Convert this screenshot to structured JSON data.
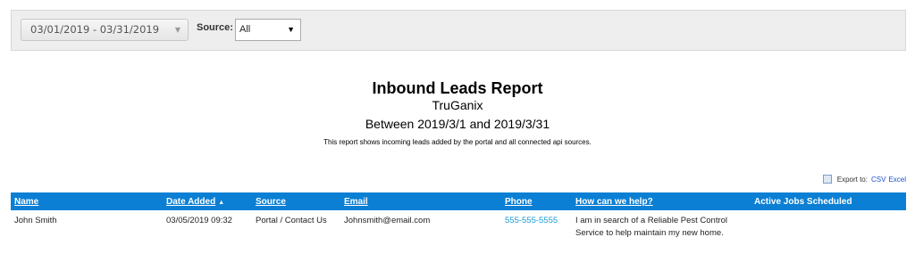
{
  "filters": {
    "date_range": "03/01/2019 - 03/31/2019",
    "source_label": "Source:",
    "source_value": "All"
  },
  "report": {
    "title": "Inbound Leads Report",
    "company": "TruGanix",
    "range": "Between 2019/3/1 and 2019/3/31",
    "description": "This report shows incoming leads added by the portal and all connected api sources."
  },
  "export": {
    "label": "Export to:",
    "csv": "CSV",
    "excel": "Excel"
  },
  "table": {
    "columns": [
      "Name",
      "Date Added",
      "Source",
      "Email",
      "Phone",
      "How can we help?",
      "Active Jobs Scheduled"
    ],
    "sort_indicator": "▲",
    "rows": [
      {
        "name": "John Smith",
        "date_added": "03/05/2019 09:32",
        "source": "Portal / Contact Us",
        "email": "Johnsmith@email.com",
        "phone": "555-555-5555",
        "help": "I am in search of a Reliable Pest Control Service to help maintain my new home.",
        "active_jobs": ""
      }
    ]
  }
}
